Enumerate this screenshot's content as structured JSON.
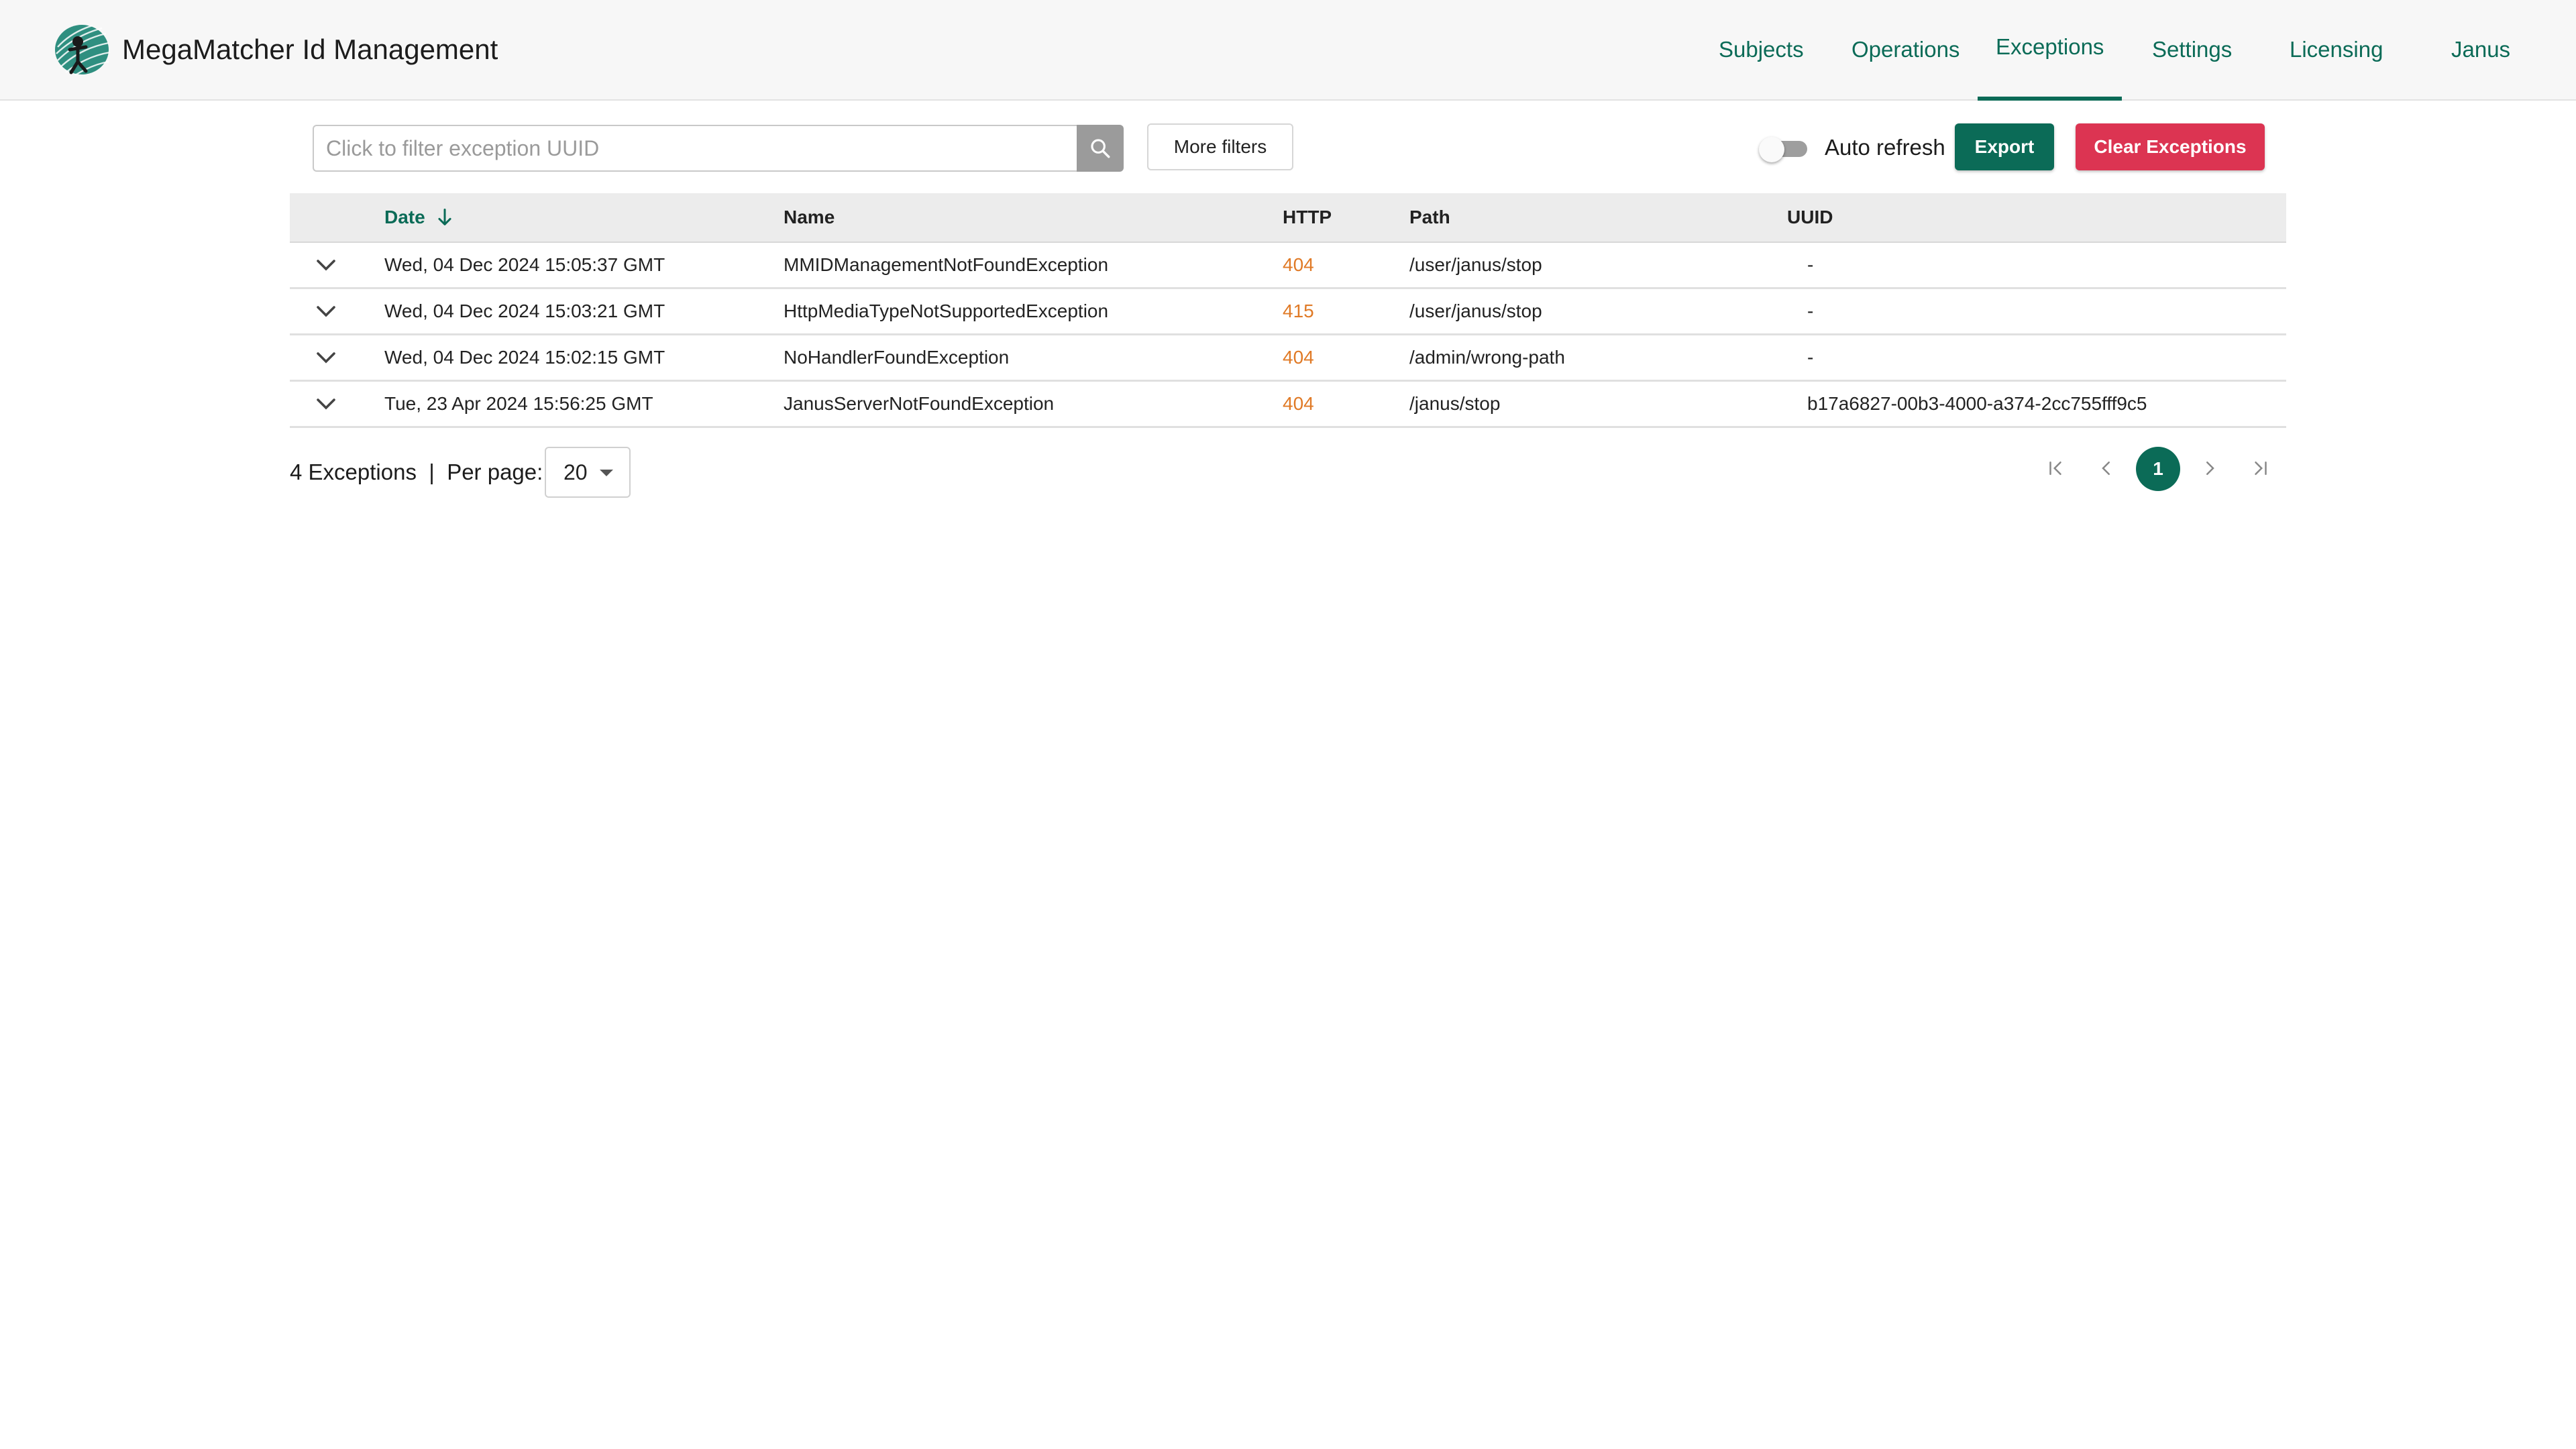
{
  "app": {
    "title": "MegaMatcher Id Management"
  },
  "nav": {
    "items": [
      {
        "label": "Subjects"
      },
      {
        "label": "Operations"
      },
      {
        "label": "Exceptions",
        "active": true
      },
      {
        "label": "Settings"
      },
      {
        "label": "Licensing"
      },
      {
        "label": "Janus"
      }
    ]
  },
  "toolbar": {
    "filter_placeholder": "Click to filter exception UUID",
    "filter_value": "",
    "more_filters_label": "More filters",
    "auto_refresh_label": "Auto refresh",
    "auto_refresh_on": false,
    "export_label": "Export",
    "clear_label": "Clear Exceptions"
  },
  "table": {
    "headers": {
      "date": "Date",
      "name": "Name",
      "http": "HTTP",
      "path": "Path",
      "uuid": "UUID"
    },
    "sort": {
      "column": "date",
      "direction": "desc"
    },
    "rows": [
      {
        "date": "Wed, 04 Dec 2024 15:05:37 GMT",
        "name": "MMIDManagementNotFoundException",
        "http": "404",
        "path": "/user/janus/stop",
        "uuid": "-"
      },
      {
        "date": "Wed, 04 Dec 2024 15:03:21 GMT",
        "name": "HttpMediaTypeNotSupportedException",
        "http": "415",
        "path": "/user/janus/stop",
        "uuid": "-"
      },
      {
        "date": "Wed, 04 Dec 2024 15:02:15 GMT",
        "name": "NoHandlerFoundException",
        "http": "404",
        "path": "/admin/wrong-path",
        "uuid": "-"
      },
      {
        "date": "Tue, 23 Apr 2024 15:56:25 GMT",
        "name": "JanusServerNotFoundException",
        "http": "404",
        "path": "/janus/stop",
        "uuid": "b17a6827-00b3-4000-a374-2cc755fff9c5"
      }
    ]
  },
  "footer": {
    "count_text": "4 Exceptions  |  Per page:",
    "per_page": "20",
    "current_page": "1"
  },
  "colors": {
    "brand": "#0b6b57",
    "danger": "#dc3452",
    "http_status": "#e07a26"
  }
}
